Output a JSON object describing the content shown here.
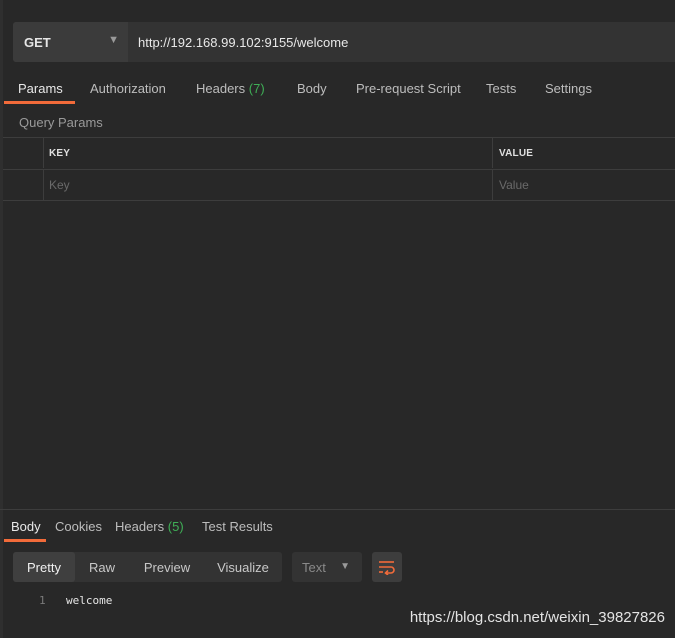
{
  "request": {
    "method": "GET",
    "url": "http://192.168.99.102:9155/welcome"
  },
  "request_tabs": [
    {
      "label": "Params",
      "active": true
    },
    {
      "label": "Authorization"
    },
    {
      "label": "Headers",
      "count": "(7)"
    },
    {
      "label": "Body"
    },
    {
      "label": "Pre-request Script"
    },
    {
      "label": "Tests"
    },
    {
      "label": "Settings"
    }
  ],
  "query_params": {
    "section_label": "Query Params",
    "columns": [
      "KEY",
      "VALUE"
    ],
    "key_placeholder": "Key",
    "value_placeholder": "Value"
  },
  "response_tabs": [
    {
      "label": "Body",
      "active": true
    },
    {
      "label": "Cookies"
    },
    {
      "label": "Headers",
      "count": "(5)"
    },
    {
      "label": "Test Results"
    }
  ],
  "view_modes": [
    {
      "label": "Pretty",
      "active": true
    },
    {
      "label": "Raw"
    },
    {
      "label": "Preview"
    },
    {
      "label": "Visualize"
    }
  ],
  "format": {
    "selected": "Text"
  },
  "response_body": [
    {
      "line": "1",
      "text": "welcome"
    }
  ],
  "watermark": "https://blog.csdn.net/weixin_39827826",
  "colors": {
    "accent": "#f26b3a",
    "count": "#3fae56",
    "background": "#282828"
  },
  "icons": {
    "method_dropdown": "chevron-down-icon",
    "format_dropdown": "chevron-down-icon",
    "wrap": "wrap-lines-icon"
  }
}
